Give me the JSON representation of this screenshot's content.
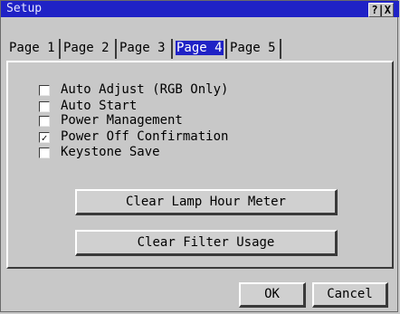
{
  "window": {
    "title": "Setup",
    "help_close": "?|X"
  },
  "tabs": [
    {
      "label": "Page 1",
      "active": false
    },
    {
      "label": "Page 2",
      "active": false
    },
    {
      "label": "Page 3",
      "active": false
    },
    {
      "label": "Page 4",
      "active": true
    },
    {
      "label": "Page 5",
      "active": false
    }
  ],
  "options": [
    {
      "label": "Auto Adjust (RGB Only)",
      "checked": false,
      "mark": ""
    },
    {
      "label": "Auto Start",
      "checked": false,
      "mark": ""
    },
    {
      "label": "Power Management",
      "checked": false,
      "mark": ""
    },
    {
      "label": "Power Off Confirmation",
      "checked": true,
      "mark": "✓"
    },
    {
      "label": "Keystone Save",
      "checked": false,
      "mark": ""
    }
  ],
  "actions": {
    "clear_lamp": "Clear Lamp Hour Meter",
    "clear_filter": "Clear Filter Usage"
  },
  "footer": {
    "ok": "OK",
    "cancel": "Cancel"
  }
}
